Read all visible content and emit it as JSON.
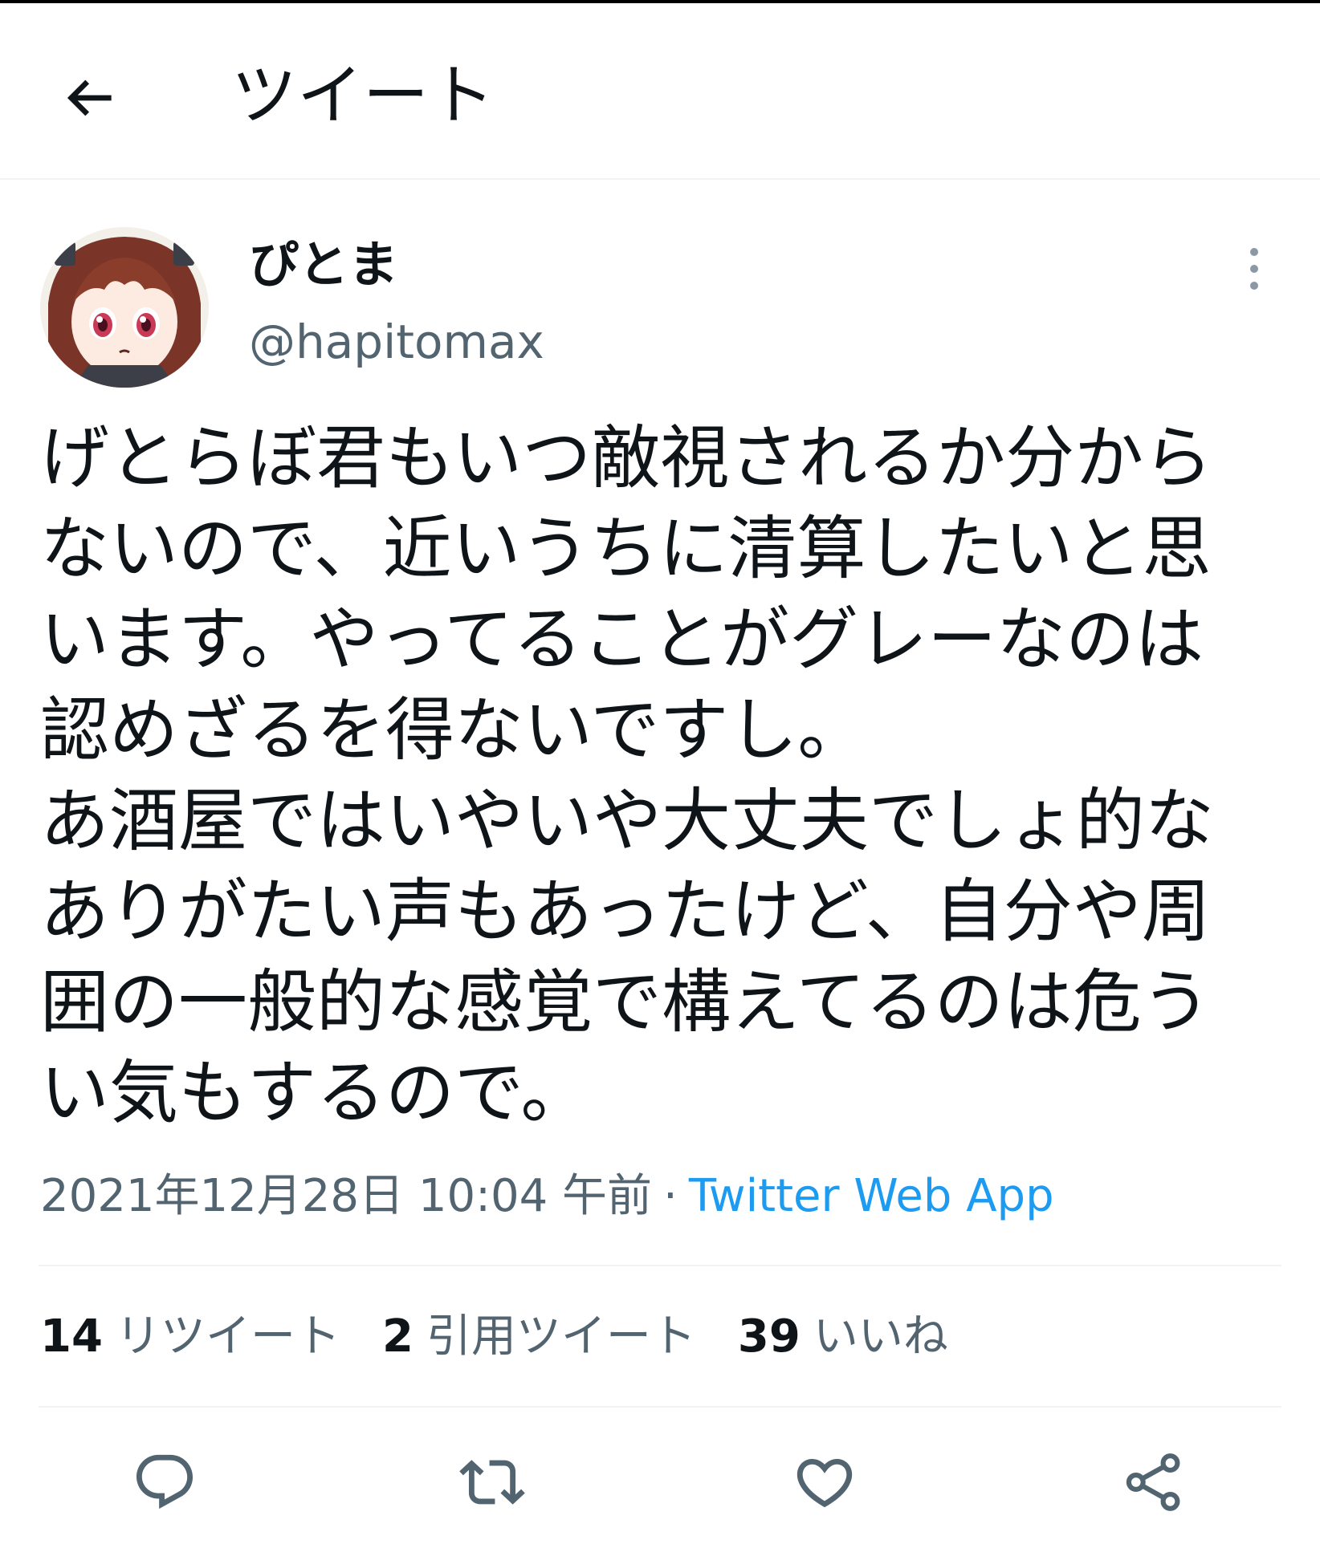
{
  "header": {
    "title": "ツイート",
    "back_icon": "arrow-left-icon"
  },
  "tweet": {
    "display_name": "ぴとま",
    "handle": "@hapitomax",
    "text_lines": [
      "げとらぼ君もいつ敵視されるか分から",
      "ないので、近いうちに清算したいと思",
      "います。やってることがグレーなのは",
      "認めざるを得ないですし。",
      "あ酒屋ではいやいや大丈夫でしょ的な",
      "ありがたい声もあったけど、自分や周",
      "囲の一般的な感覚で構えてるのは危う",
      "い気もするので。"
    ],
    "timestamp": "2021年12月28日 10:04 午前",
    "separator": "·",
    "source": "Twitter Web App"
  },
  "stats": {
    "retweets": {
      "count": "14",
      "label": "リツイート"
    },
    "quotes": {
      "count": "2",
      "label": "引用ツイート"
    },
    "likes": {
      "count": "39",
      "label": "いいね"
    }
  },
  "actions": [
    "reply-icon",
    "retweet-icon",
    "like-icon",
    "share-icon"
  ],
  "colors": {
    "text": "#0f1419",
    "secondary": "#536471",
    "link": "#1d9bf0",
    "divider": "#eff3f4"
  }
}
